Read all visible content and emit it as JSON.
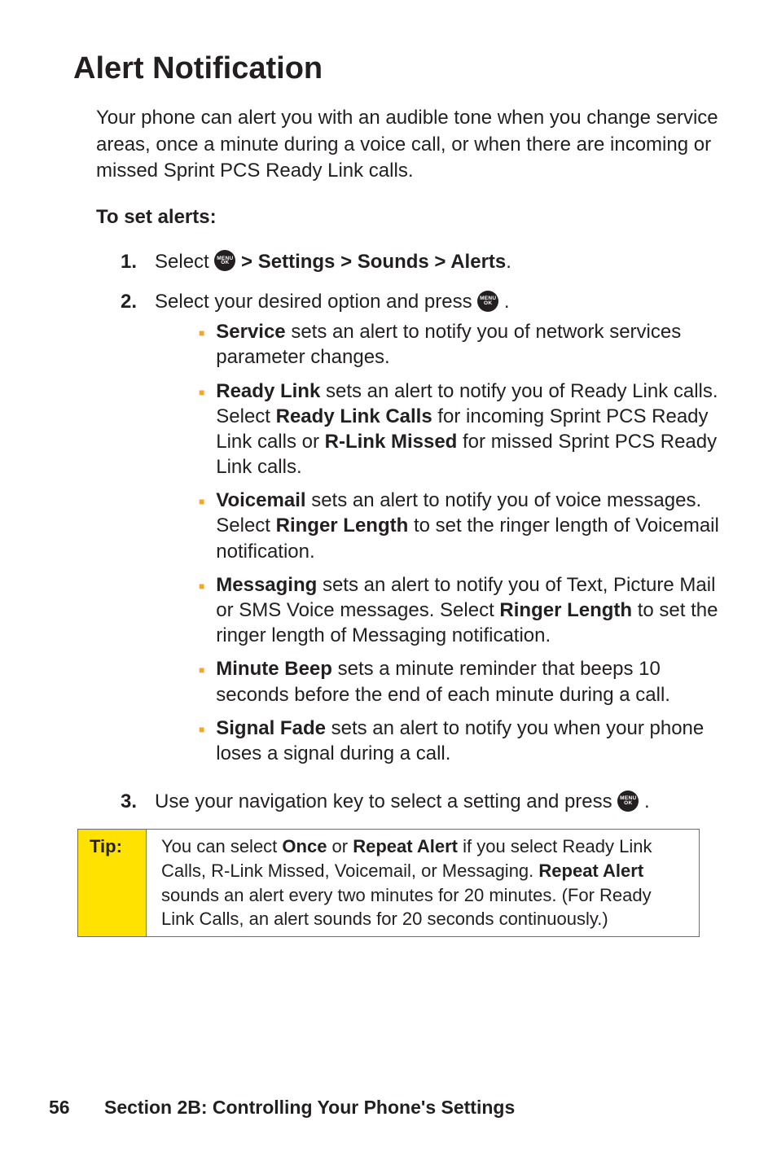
{
  "heading": "Alert Notification",
  "intro": "Your phone can alert you with an audible tone when you change service areas, once a minute during a voice call, or when there are incoming or missed Sprint PCS Ready Link calls.",
  "subheading": "To set alerts:",
  "step1": {
    "num": "1.",
    "prefix": "Select ",
    "suffix": "  > Settings > Sounds > Alerts",
    "end": "."
  },
  "step2": {
    "num": "2.",
    "prefix": "Select your desired option and press ",
    "end": " ."
  },
  "bullets": [
    {
      "bold": "Service",
      "rest": " sets an alert to notify you of network services parameter changes."
    },
    {
      "bold": "Ready Link",
      "parts": [
        " sets an alert to notify you of Ready Link calls. Select ",
        {
          "b": "Ready Link Calls"
        },
        " for incoming Sprint PCS Ready Link calls or ",
        {
          "b": "R-Link Missed"
        },
        " for missed Sprint PCS Ready Link calls."
      ]
    },
    {
      "bold": "Voicemail",
      "parts": [
        " sets an alert to notify you of voice messages. Select ",
        {
          "b": "Ringer Length"
        },
        " to set the ringer length of Voicemail notification."
      ]
    },
    {
      "bold": "Messaging",
      "parts": [
        " sets an alert to notify you of Text, Picture Mail or SMS Voice messages. Select ",
        {
          "b": "Ringer Length"
        },
        " to set the ringer length of Messaging notification."
      ]
    },
    {
      "bold": "Minute Beep",
      "rest": " sets a minute reminder that beeps 10 seconds before the end of each minute during a call."
    },
    {
      "bold": "Signal Fade",
      "rest": " sets an alert to notify you when your phone loses a signal during a call."
    }
  ],
  "step3": {
    "num": "3.",
    "prefix": "Use your navigation key to select a setting and press ",
    "end": " ."
  },
  "tip": {
    "label": "Tip:",
    "parts": [
      "You can select ",
      {
        "b": "Once"
      },
      " or ",
      {
        "b": "Repeat Alert"
      },
      " if you select Ready Link Calls, R-Link Missed, Voicemail, or Messaging. ",
      {
        "b": "Repeat Alert"
      },
      " sounds an alert every two minutes for 20 minutes. (For Ready Link Calls, an alert sounds for 20 seconds continuously.)"
    ]
  },
  "icon": {
    "top": "MENU",
    "bot": "OK"
  },
  "footer": {
    "page": "56",
    "section": "Section 2B: Controlling Your Phone's Settings"
  }
}
